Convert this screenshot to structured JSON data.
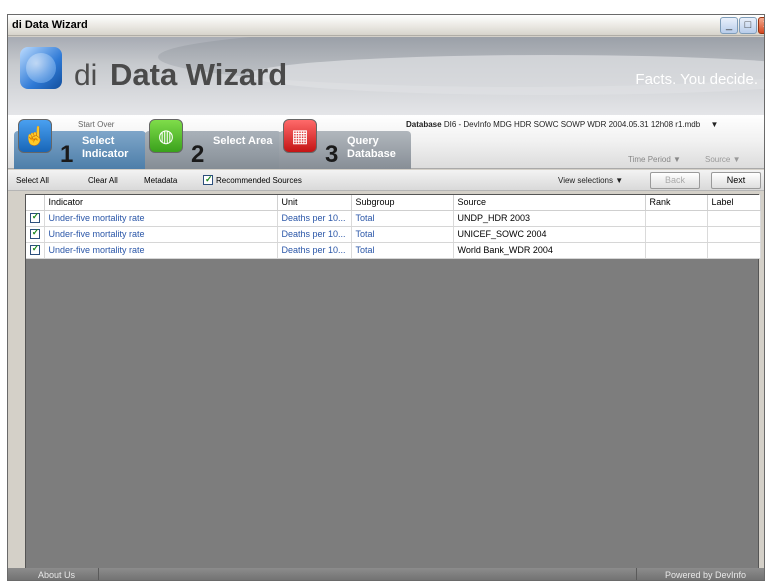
{
  "window": {
    "title": "di Data Wizard"
  },
  "banner": {
    "logo_di": "di",
    "logo_data_wizard": "Data Wizard",
    "tagline": "Facts. You decide."
  },
  "steps": {
    "start_over": "Start Over",
    "items": [
      {
        "number": "1",
        "label": "Select Indicator",
        "color": "#4d7ea9"
      },
      {
        "number": "2",
        "label": "Select Area",
        "color": "#3aa11c"
      },
      {
        "number": "3",
        "label": "Query Database",
        "color": "#c41414"
      }
    ]
  },
  "database": {
    "prefix": "Database",
    "value": "DI6 - DevInfo MDG HDR SOWC SOWP WDR 2004.05.31 12h08 r1.mdb"
  },
  "filters": {
    "time_period": "Time Period",
    "source": "Source"
  },
  "toolbar": {
    "select_all": "Select All",
    "clear_all": "Clear All",
    "metadata": "Metadata",
    "recommended_sources": "Recommended Sources",
    "recommended_checked": true,
    "view_selections": "View selections",
    "back": "Back",
    "next": "Next"
  },
  "table": {
    "columns": [
      "Indicator",
      "Unit",
      "Subgroup",
      "Source",
      "Rank",
      "Label"
    ],
    "rows": [
      {
        "checked": true,
        "indicator": "Under-five mortality rate",
        "unit": "Deaths per 10...",
        "subgroup": "Total",
        "source": "UNDP_HDR 2003",
        "rank": "",
        "label": ""
      },
      {
        "checked": true,
        "indicator": "Under-five mortality rate",
        "unit": "Deaths per 10...",
        "subgroup": "Total",
        "source": "UNICEF_SOWC 2004",
        "rank": "",
        "label": ""
      },
      {
        "checked": true,
        "indicator": "Under-five mortality rate",
        "unit": "Deaths per 10...",
        "subgroup": "Total",
        "source": "World Bank_WDR 2004",
        "rank": "",
        "label": ""
      }
    ]
  },
  "status": {
    "about": "About Us",
    "powered": "Powered by DevInfo"
  }
}
